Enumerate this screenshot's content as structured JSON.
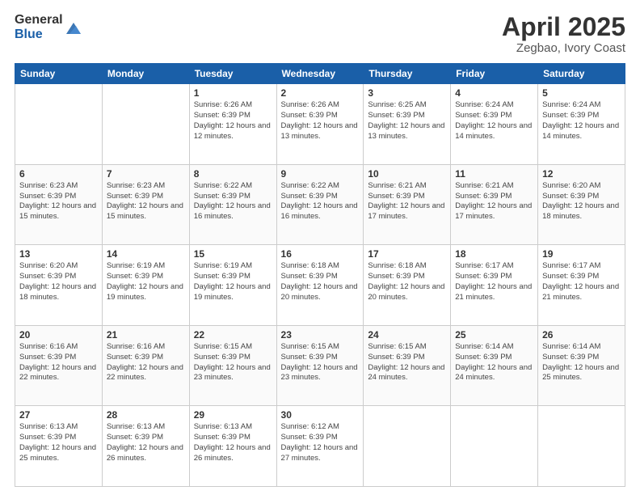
{
  "logo": {
    "general": "General",
    "blue": "Blue"
  },
  "title": {
    "main": "April 2025",
    "sub": "Zegbao, Ivory Coast"
  },
  "weekdays": [
    "Sunday",
    "Monday",
    "Tuesday",
    "Wednesday",
    "Thursday",
    "Friday",
    "Saturday"
  ],
  "weeks": [
    [
      {
        "day": "",
        "sunrise": "",
        "sunset": "",
        "daylight": ""
      },
      {
        "day": "",
        "sunrise": "",
        "sunset": "",
        "daylight": ""
      },
      {
        "day": "1",
        "sunrise": "Sunrise: 6:26 AM",
        "sunset": "Sunset: 6:39 PM",
        "daylight": "Daylight: 12 hours and 12 minutes."
      },
      {
        "day": "2",
        "sunrise": "Sunrise: 6:26 AM",
        "sunset": "Sunset: 6:39 PM",
        "daylight": "Daylight: 12 hours and 13 minutes."
      },
      {
        "day": "3",
        "sunrise": "Sunrise: 6:25 AM",
        "sunset": "Sunset: 6:39 PM",
        "daylight": "Daylight: 12 hours and 13 minutes."
      },
      {
        "day": "4",
        "sunrise": "Sunrise: 6:24 AM",
        "sunset": "Sunset: 6:39 PM",
        "daylight": "Daylight: 12 hours and 14 minutes."
      },
      {
        "day": "5",
        "sunrise": "Sunrise: 6:24 AM",
        "sunset": "Sunset: 6:39 PM",
        "daylight": "Daylight: 12 hours and 14 minutes."
      }
    ],
    [
      {
        "day": "6",
        "sunrise": "Sunrise: 6:23 AM",
        "sunset": "Sunset: 6:39 PM",
        "daylight": "Daylight: 12 hours and 15 minutes."
      },
      {
        "day": "7",
        "sunrise": "Sunrise: 6:23 AM",
        "sunset": "Sunset: 6:39 PM",
        "daylight": "Daylight: 12 hours and 15 minutes."
      },
      {
        "day": "8",
        "sunrise": "Sunrise: 6:22 AM",
        "sunset": "Sunset: 6:39 PM",
        "daylight": "Daylight: 12 hours and 16 minutes."
      },
      {
        "day": "9",
        "sunrise": "Sunrise: 6:22 AM",
        "sunset": "Sunset: 6:39 PM",
        "daylight": "Daylight: 12 hours and 16 minutes."
      },
      {
        "day": "10",
        "sunrise": "Sunrise: 6:21 AM",
        "sunset": "Sunset: 6:39 PM",
        "daylight": "Daylight: 12 hours and 17 minutes."
      },
      {
        "day": "11",
        "sunrise": "Sunrise: 6:21 AM",
        "sunset": "Sunset: 6:39 PM",
        "daylight": "Daylight: 12 hours and 17 minutes."
      },
      {
        "day": "12",
        "sunrise": "Sunrise: 6:20 AM",
        "sunset": "Sunset: 6:39 PM",
        "daylight": "Daylight: 12 hours and 18 minutes."
      }
    ],
    [
      {
        "day": "13",
        "sunrise": "Sunrise: 6:20 AM",
        "sunset": "Sunset: 6:39 PM",
        "daylight": "Daylight: 12 hours and 18 minutes."
      },
      {
        "day": "14",
        "sunrise": "Sunrise: 6:19 AM",
        "sunset": "Sunset: 6:39 PM",
        "daylight": "Daylight: 12 hours and 19 minutes."
      },
      {
        "day": "15",
        "sunrise": "Sunrise: 6:19 AM",
        "sunset": "Sunset: 6:39 PM",
        "daylight": "Daylight: 12 hours and 19 minutes."
      },
      {
        "day": "16",
        "sunrise": "Sunrise: 6:18 AM",
        "sunset": "Sunset: 6:39 PM",
        "daylight": "Daylight: 12 hours and 20 minutes."
      },
      {
        "day": "17",
        "sunrise": "Sunrise: 6:18 AM",
        "sunset": "Sunset: 6:39 PM",
        "daylight": "Daylight: 12 hours and 20 minutes."
      },
      {
        "day": "18",
        "sunrise": "Sunrise: 6:17 AM",
        "sunset": "Sunset: 6:39 PM",
        "daylight": "Daylight: 12 hours and 21 minutes."
      },
      {
        "day": "19",
        "sunrise": "Sunrise: 6:17 AM",
        "sunset": "Sunset: 6:39 PM",
        "daylight": "Daylight: 12 hours and 21 minutes."
      }
    ],
    [
      {
        "day": "20",
        "sunrise": "Sunrise: 6:16 AM",
        "sunset": "Sunset: 6:39 PM",
        "daylight": "Daylight: 12 hours and 22 minutes."
      },
      {
        "day": "21",
        "sunrise": "Sunrise: 6:16 AM",
        "sunset": "Sunset: 6:39 PM",
        "daylight": "Daylight: 12 hours and 22 minutes."
      },
      {
        "day": "22",
        "sunrise": "Sunrise: 6:15 AM",
        "sunset": "Sunset: 6:39 PM",
        "daylight": "Daylight: 12 hours and 23 minutes."
      },
      {
        "day": "23",
        "sunrise": "Sunrise: 6:15 AM",
        "sunset": "Sunset: 6:39 PM",
        "daylight": "Daylight: 12 hours and 23 minutes."
      },
      {
        "day": "24",
        "sunrise": "Sunrise: 6:15 AM",
        "sunset": "Sunset: 6:39 PM",
        "daylight": "Daylight: 12 hours and 24 minutes."
      },
      {
        "day": "25",
        "sunrise": "Sunrise: 6:14 AM",
        "sunset": "Sunset: 6:39 PM",
        "daylight": "Daylight: 12 hours and 24 minutes."
      },
      {
        "day": "26",
        "sunrise": "Sunrise: 6:14 AM",
        "sunset": "Sunset: 6:39 PM",
        "daylight": "Daylight: 12 hours and 25 minutes."
      }
    ],
    [
      {
        "day": "27",
        "sunrise": "Sunrise: 6:13 AM",
        "sunset": "Sunset: 6:39 PM",
        "daylight": "Daylight: 12 hours and 25 minutes."
      },
      {
        "day": "28",
        "sunrise": "Sunrise: 6:13 AM",
        "sunset": "Sunset: 6:39 PM",
        "daylight": "Daylight: 12 hours and 26 minutes."
      },
      {
        "day": "29",
        "sunrise": "Sunrise: 6:13 AM",
        "sunset": "Sunset: 6:39 PM",
        "daylight": "Daylight: 12 hours and 26 minutes."
      },
      {
        "day": "30",
        "sunrise": "Sunrise: 6:12 AM",
        "sunset": "Sunset: 6:39 PM",
        "daylight": "Daylight: 12 hours and 27 minutes."
      },
      {
        "day": "",
        "sunrise": "",
        "sunset": "",
        "daylight": ""
      },
      {
        "day": "",
        "sunrise": "",
        "sunset": "",
        "daylight": ""
      },
      {
        "day": "",
        "sunrise": "",
        "sunset": "",
        "daylight": ""
      }
    ]
  ]
}
